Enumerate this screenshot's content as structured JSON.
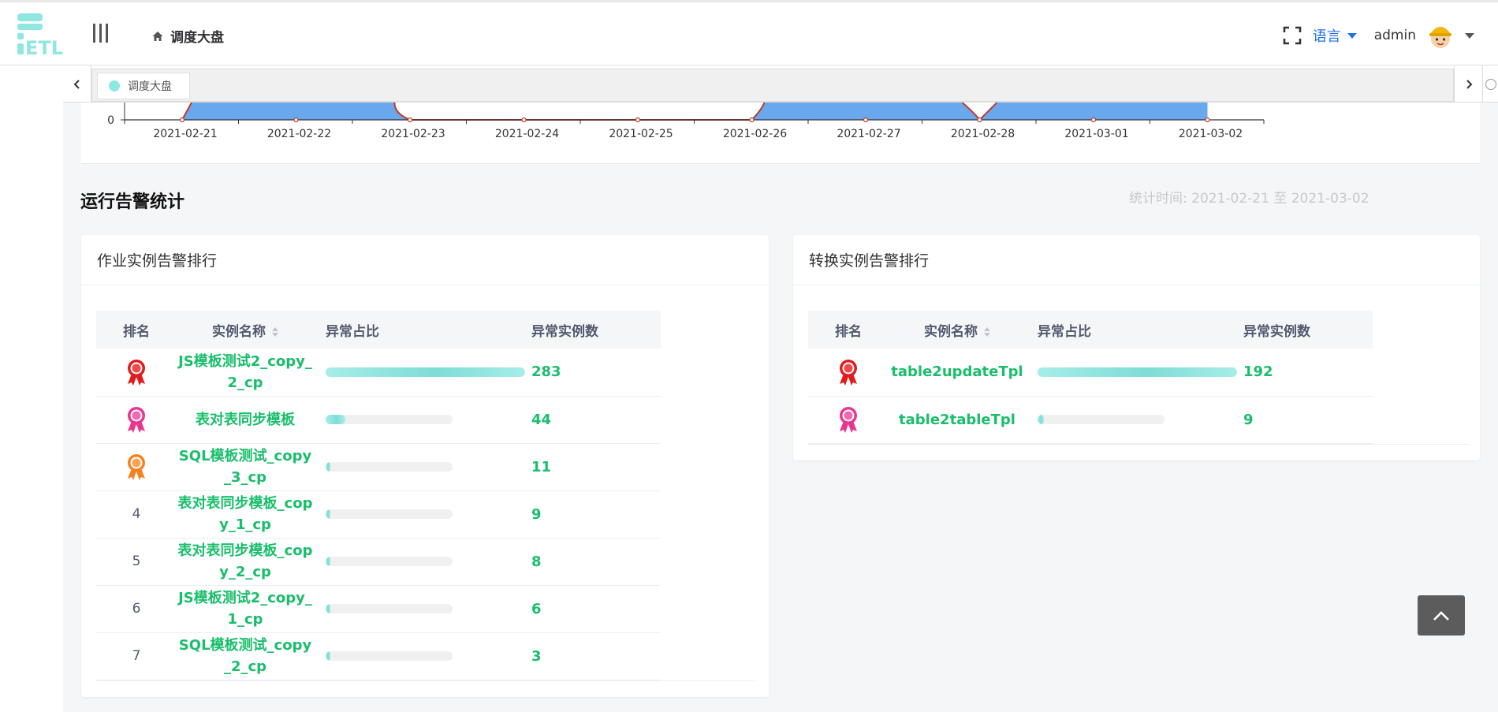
{
  "header": {
    "breadcrumb": "调度大盘",
    "language_label": "语言",
    "username": "admin",
    "icons": [
      "logo-etl",
      "hamburger-icon",
      "home-icon",
      "fullscreen-icon",
      "caret-down-icon",
      "avatar"
    ]
  },
  "tabs": {
    "items": [
      {
        "label": "调度大盘"
      }
    ],
    "accent_color": "#8fe7e1"
  },
  "chart_data": {
    "type": "area",
    "x": [
      "2021-02-21",
      "2021-02-22",
      "2021-02-23",
      "2021-02-24",
      "2021-02-25",
      "2021-02-26",
      "2021-02-27",
      "2021-02-28",
      "2021-03-01",
      "2021-03-02"
    ],
    "y_tick_visible": "0",
    "colors": {
      "area": "#6aa8ee",
      "line": "#c0392b"
    }
  },
  "alarm_section": {
    "title": "运行告警统计",
    "stat_time": "统计时间: 2021-02-21 至 2021-03-02"
  },
  "job_panel": {
    "title": "作业实例告警排行",
    "columns": {
      "rank": "排名",
      "name": "实例名称",
      "ratio": "异常占比",
      "count": "异常实例数"
    },
    "rows": [
      {
        "rank": "1",
        "medal": "gold-medal-icon",
        "name": "JS模板测试2_copy_2_cp",
        "ratio": 1.0,
        "count": "283"
      },
      {
        "rank": "2",
        "medal": "silver-medal-icon",
        "name": "表对表同步模板",
        "ratio": 0.155,
        "count": "44"
      },
      {
        "rank": "3",
        "medal": "bronze-medal-icon",
        "name": "SQL模板测试_copy_3_cp",
        "ratio": 0.039,
        "count": "11"
      },
      {
        "rank": "4",
        "medal": "",
        "name": "表对表同步模板_copy_1_cp",
        "ratio": 0.032,
        "count": "9"
      },
      {
        "rank": "5",
        "medal": "",
        "name": "表对表同步模板_copy_2_cp",
        "ratio": 0.028,
        "count": "8"
      },
      {
        "rank": "6",
        "medal": "",
        "name": "JS模板测试2_copy_1_cp",
        "ratio": 0.021,
        "count": "6"
      },
      {
        "rank": "7",
        "medal": "",
        "name": "SQL模板测试_copy_2_cp",
        "ratio": 0.011,
        "count": "3"
      }
    ]
  },
  "trans_panel": {
    "title": "转换实例告警排行",
    "columns": {
      "rank": "排名",
      "name": "实例名称",
      "ratio": "异常占比",
      "count": "异常实例数"
    },
    "rows": [
      {
        "rank": "1",
        "medal": "gold-medal-icon",
        "name": "table2updateTpl",
        "ratio": 1.0,
        "count": "192"
      },
      {
        "rank": "2",
        "medal": "silver-medal-icon",
        "name": "table2tableTpl",
        "ratio": 0.047,
        "count": "9"
      }
    ]
  }
}
